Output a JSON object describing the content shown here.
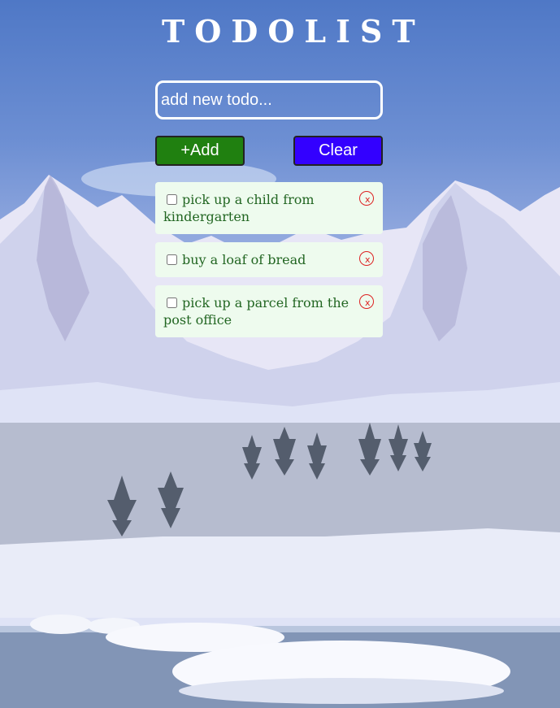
{
  "app": {
    "title": "TODOLIST"
  },
  "input": {
    "placeholder": "add new todo...",
    "value": ""
  },
  "buttons": {
    "add_label": "+Add",
    "clear_label": "Clear",
    "add_color": "#208010",
    "clear_color": "#3300ff"
  },
  "todos": [
    {
      "text": "pick up a child from kindergarten",
      "checked": false,
      "delete_label": "x"
    },
    {
      "text": "buy a loaf of bread",
      "checked": false,
      "delete_label": "x"
    },
    {
      "text": "pick up a parcel from the post office",
      "checked": false,
      "delete_label": "x"
    }
  ],
  "background": {
    "icon": "snowy-mountain-landscape-image"
  }
}
